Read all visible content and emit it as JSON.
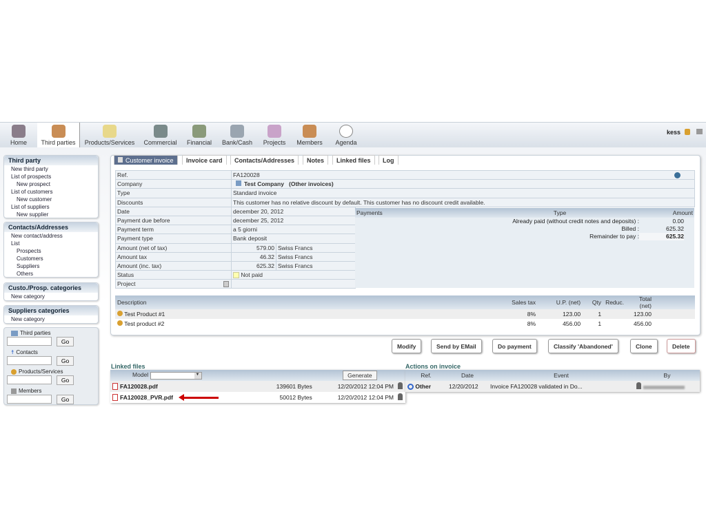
{
  "topmenu": {
    "items": [
      "Home",
      "Third parties",
      "Products/Services",
      "Commercial",
      "Financial",
      "Bank/Cash",
      "Projects",
      "Members",
      "Agenda"
    ],
    "user": "kess"
  },
  "sidebar": {
    "third_party": {
      "title": "Third party",
      "items": [
        "New third party",
        "List of prospects",
        "New prospect",
        "List of customers",
        "New customer",
        "List of suppliers",
        "New supplier"
      ]
    },
    "contacts": {
      "title": "Contacts/Addresses",
      "items": [
        "New contact/address",
        "List",
        "Prospects",
        "Customers",
        "Suppliers",
        "Others"
      ]
    },
    "custo_cat": {
      "title": "Custo./Prosp. categories",
      "items": [
        "New category"
      ]
    },
    "supp_cat": {
      "title": "Suppliers categories",
      "items": [
        "New category"
      ]
    },
    "search": {
      "labels": [
        "Third parties",
        "Contacts",
        "Products/Services",
        "Members"
      ],
      "go": "Go"
    }
  },
  "tabs": [
    "Customer invoice",
    "Invoice card",
    "Contacts/Addresses",
    "Notes",
    "Linked files",
    "Log"
  ],
  "card": {
    "rows": [
      [
        "Ref.",
        "FA120028"
      ],
      [
        "Company",
        "Test Company"
      ],
      [
        "Type",
        "Standard invoice"
      ],
      [
        "Discounts",
        "This customer has no relative discount by default. This customer has no discount credit available."
      ],
      [
        "Date",
        "december 20, 2012"
      ],
      [
        "Payment due before",
        "december 25, 2012"
      ],
      [
        "Payment term",
        "a 5 giorni"
      ],
      [
        "Payment type",
        "Bank deposit"
      ],
      [
        "Amount (net of tax)",
        "579.00",
        "Swiss Francs"
      ],
      [
        "Amount tax",
        "46.32",
        "Swiss Francs"
      ],
      [
        "Amount (inc. tax)",
        "625.32",
        "Swiss Francs"
      ],
      [
        "Status",
        "Not paid"
      ],
      [
        "Project",
        ""
      ]
    ],
    "other_invoices": "(Other invoices)"
  },
  "payments": {
    "headers": [
      "Payments",
      "Type",
      "Amount"
    ],
    "rows": [
      [
        "Already paid (without credit notes and deposits) :",
        "0.00"
      ],
      [
        "Billed :",
        "625.32"
      ],
      [
        "Remainder to pay :",
        "625.32"
      ]
    ]
  },
  "lines": {
    "headers": [
      "Description",
      "Sales tax",
      "U.P. (net)",
      "Qty",
      "Reduc.",
      "Total (net)"
    ],
    "rows": [
      [
        "Test Product #1",
        "8%",
        "123.00",
        "1",
        "",
        "123.00"
      ],
      [
        "Test product #2",
        "8%",
        "456.00",
        "1",
        "",
        "456.00"
      ]
    ]
  },
  "buttons": [
    "Modify",
    "Send by EMail",
    "Do payment",
    "Classify 'Abandoned'",
    "Clone",
    "Delete"
  ],
  "linked_files": {
    "title": "Linked files",
    "model_label": "Model",
    "generate": "Generate",
    "files": [
      [
        "FA120028.pdf",
        "139601 Bytes",
        "12/20/2012 12:04 PM"
      ],
      [
        "FA120028_PVR.pdf",
        "50012 Bytes",
        "12/20/2012 12:04 PM"
      ]
    ]
  },
  "actions": {
    "title": "Actions on invoice",
    "headers": [
      "Ref.",
      "Date",
      "Event",
      "By"
    ],
    "rows": [
      [
        "Other",
        "12/20/2012",
        "Invoice FA120028 validated in Do..."
      ]
    ]
  }
}
